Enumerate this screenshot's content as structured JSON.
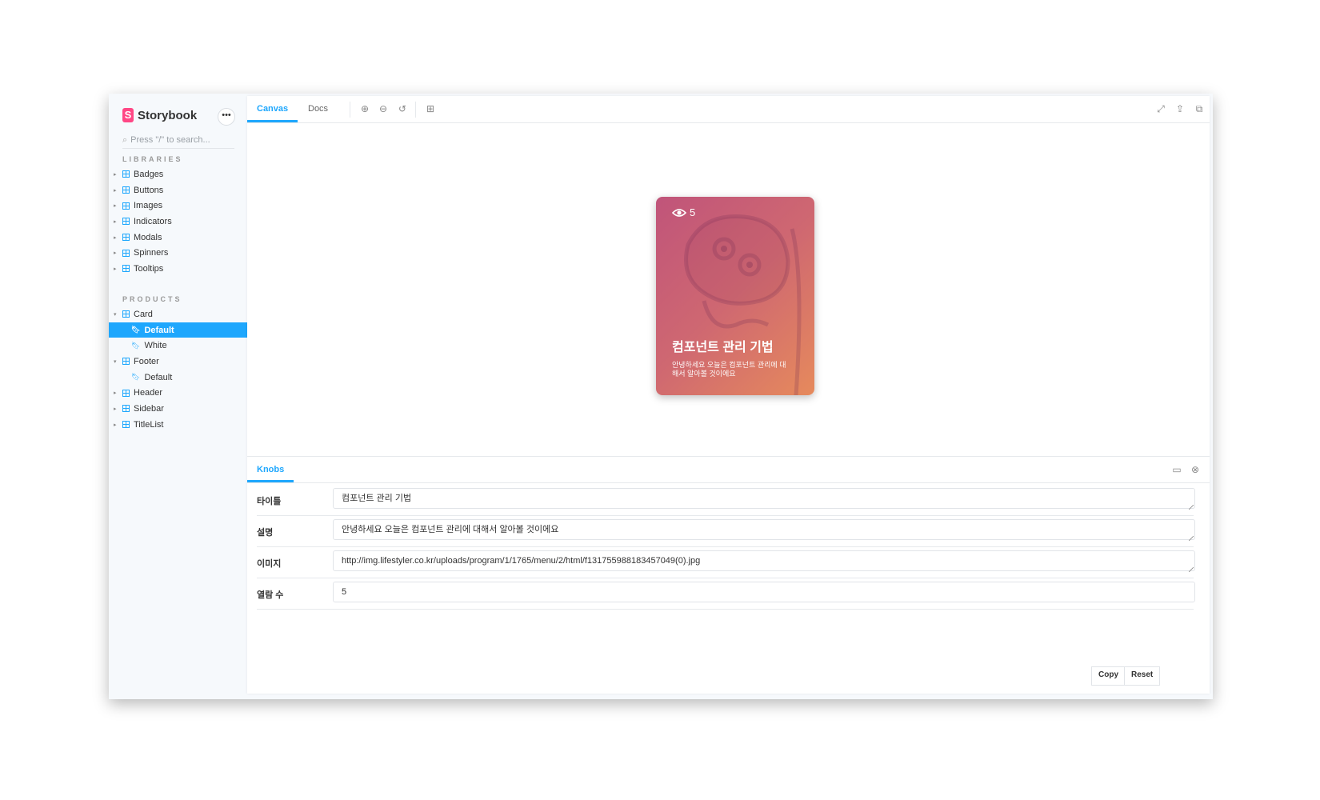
{
  "brand": {
    "name": "Storybook",
    "logo_letter": "S",
    "menu_icon": "ellipsis-icon"
  },
  "search": {
    "placeholder": "Press \"/\" to search..."
  },
  "sidebar": {
    "sections": [
      {
        "title": "LIBRARIES",
        "items": [
          {
            "label": "Badges",
            "type": "component"
          },
          {
            "label": "Buttons",
            "type": "component"
          },
          {
            "label": "Images",
            "type": "component"
          },
          {
            "label": "Indicators",
            "type": "component"
          },
          {
            "label": "Modals",
            "type": "component"
          },
          {
            "label": "Spinners",
            "type": "component"
          },
          {
            "label": "Tooltips",
            "type": "component"
          }
        ]
      },
      {
        "title": "PRODUCTS",
        "items": [
          {
            "label": "Card",
            "type": "component",
            "expanded": true
          },
          {
            "label": "Default",
            "type": "story",
            "selected": true
          },
          {
            "label": "White",
            "type": "story"
          },
          {
            "label": "Footer",
            "type": "component",
            "expanded": true
          },
          {
            "label": "Default",
            "type": "story"
          },
          {
            "label": "Header",
            "type": "component"
          },
          {
            "label": "Sidebar",
            "type": "component"
          },
          {
            "label": "TitleList",
            "type": "component"
          }
        ]
      }
    ]
  },
  "toolbar": {
    "tabs": [
      "Canvas",
      "Docs"
    ],
    "active_tab": "Canvas",
    "tools": [
      "zoom-in-icon",
      "zoom-out-icon",
      "zoom-reset-icon",
      "grid-icon"
    ],
    "right_tools": [
      "fullscreen-icon",
      "share-icon",
      "copy-link-icon"
    ]
  },
  "card": {
    "views": "5",
    "title": "컴포넌트 관리 기법",
    "description": "안녕하세요 오늘은 컴포넌트 관리에 대해서 알아볼 것이에요",
    "gradient": [
      "#c0547a",
      "#cf6871",
      "#e68a5c"
    ]
  },
  "addons": {
    "tab": "Knobs",
    "knobs": [
      {
        "label": "타이틀",
        "value": "컴포넌트 관리 기법"
      },
      {
        "label": "설명",
        "value": "안녕하세요 오늘은 컴포넌트 관리에 대해서 알아볼 것이에요"
      },
      {
        "label": "이미지",
        "value": "http://img.lifestyler.co.kr/uploads/program/1/1765/menu/2/html/f131755988183457049(0).jpg"
      },
      {
        "label": "열람 수",
        "value": "5"
      }
    ],
    "copy_label": "Copy",
    "reset_label": "Reset"
  },
  "colors": {
    "accent": "#1ea7fd",
    "storybook_pink": "#ff4785"
  }
}
